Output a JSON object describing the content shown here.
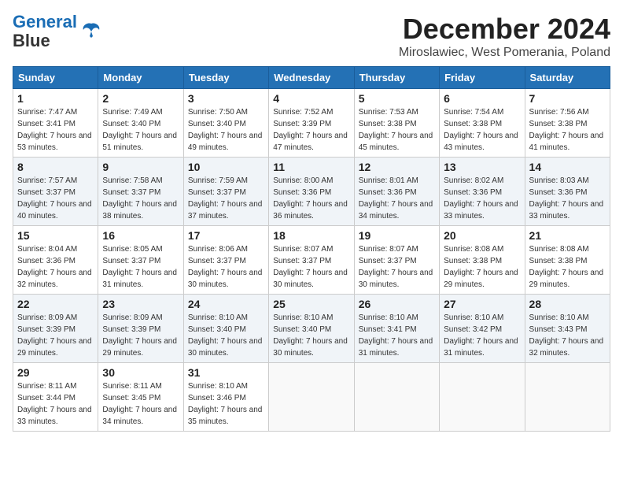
{
  "header": {
    "logo_line1": "General",
    "logo_line2": "Blue",
    "month_title": "December 2024",
    "location": "Miroslawiec, West Pomerania, Poland"
  },
  "days_of_week": [
    "Sunday",
    "Monday",
    "Tuesday",
    "Wednesday",
    "Thursday",
    "Friday",
    "Saturday"
  ],
  "weeks": [
    [
      {
        "day": "1",
        "sunrise": "7:47 AM",
        "sunset": "3:41 PM",
        "daylight": "7 hours and 53 minutes."
      },
      {
        "day": "2",
        "sunrise": "7:49 AM",
        "sunset": "3:40 PM",
        "daylight": "7 hours and 51 minutes."
      },
      {
        "day": "3",
        "sunrise": "7:50 AM",
        "sunset": "3:40 PM",
        "daylight": "7 hours and 49 minutes."
      },
      {
        "day": "4",
        "sunrise": "7:52 AM",
        "sunset": "3:39 PM",
        "daylight": "7 hours and 47 minutes."
      },
      {
        "day": "5",
        "sunrise": "7:53 AM",
        "sunset": "3:38 PM",
        "daylight": "7 hours and 45 minutes."
      },
      {
        "day": "6",
        "sunrise": "7:54 AM",
        "sunset": "3:38 PM",
        "daylight": "7 hours and 43 minutes."
      },
      {
        "day": "7",
        "sunrise": "7:56 AM",
        "sunset": "3:38 PM",
        "daylight": "7 hours and 41 minutes."
      }
    ],
    [
      {
        "day": "8",
        "sunrise": "7:57 AM",
        "sunset": "3:37 PM",
        "daylight": "7 hours and 40 minutes."
      },
      {
        "day": "9",
        "sunrise": "7:58 AM",
        "sunset": "3:37 PM",
        "daylight": "7 hours and 38 minutes."
      },
      {
        "day": "10",
        "sunrise": "7:59 AM",
        "sunset": "3:37 PM",
        "daylight": "7 hours and 37 minutes."
      },
      {
        "day": "11",
        "sunrise": "8:00 AM",
        "sunset": "3:36 PM",
        "daylight": "7 hours and 36 minutes."
      },
      {
        "day": "12",
        "sunrise": "8:01 AM",
        "sunset": "3:36 PM",
        "daylight": "7 hours and 34 minutes."
      },
      {
        "day": "13",
        "sunrise": "8:02 AM",
        "sunset": "3:36 PM",
        "daylight": "7 hours and 33 minutes."
      },
      {
        "day": "14",
        "sunrise": "8:03 AM",
        "sunset": "3:36 PM",
        "daylight": "7 hours and 33 minutes."
      }
    ],
    [
      {
        "day": "15",
        "sunrise": "8:04 AM",
        "sunset": "3:36 PM",
        "daylight": "7 hours and 32 minutes."
      },
      {
        "day": "16",
        "sunrise": "8:05 AM",
        "sunset": "3:37 PM",
        "daylight": "7 hours and 31 minutes."
      },
      {
        "day": "17",
        "sunrise": "8:06 AM",
        "sunset": "3:37 PM",
        "daylight": "7 hours and 30 minutes."
      },
      {
        "day": "18",
        "sunrise": "8:07 AM",
        "sunset": "3:37 PM",
        "daylight": "7 hours and 30 minutes."
      },
      {
        "day": "19",
        "sunrise": "8:07 AM",
        "sunset": "3:37 PM",
        "daylight": "7 hours and 30 minutes."
      },
      {
        "day": "20",
        "sunrise": "8:08 AM",
        "sunset": "3:38 PM",
        "daylight": "7 hours and 29 minutes."
      },
      {
        "day": "21",
        "sunrise": "8:08 AM",
        "sunset": "3:38 PM",
        "daylight": "7 hours and 29 minutes."
      }
    ],
    [
      {
        "day": "22",
        "sunrise": "8:09 AM",
        "sunset": "3:39 PM",
        "daylight": "7 hours and 29 minutes."
      },
      {
        "day": "23",
        "sunrise": "8:09 AM",
        "sunset": "3:39 PM",
        "daylight": "7 hours and 29 minutes."
      },
      {
        "day": "24",
        "sunrise": "8:10 AM",
        "sunset": "3:40 PM",
        "daylight": "7 hours and 30 minutes."
      },
      {
        "day": "25",
        "sunrise": "8:10 AM",
        "sunset": "3:40 PM",
        "daylight": "7 hours and 30 minutes."
      },
      {
        "day": "26",
        "sunrise": "8:10 AM",
        "sunset": "3:41 PM",
        "daylight": "7 hours and 31 minutes."
      },
      {
        "day": "27",
        "sunrise": "8:10 AM",
        "sunset": "3:42 PM",
        "daylight": "7 hours and 31 minutes."
      },
      {
        "day": "28",
        "sunrise": "8:10 AM",
        "sunset": "3:43 PM",
        "daylight": "7 hours and 32 minutes."
      }
    ],
    [
      {
        "day": "29",
        "sunrise": "8:11 AM",
        "sunset": "3:44 PM",
        "daylight": "7 hours and 33 minutes."
      },
      {
        "day": "30",
        "sunrise": "8:11 AM",
        "sunset": "3:45 PM",
        "daylight": "7 hours and 34 minutes."
      },
      {
        "day": "31",
        "sunrise": "8:10 AM",
        "sunset": "3:46 PM",
        "daylight": "7 hours and 35 minutes."
      },
      null,
      null,
      null,
      null
    ]
  ],
  "labels": {
    "sunrise": "Sunrise:",
    "sunset": "Sunset:",
    "daylight": "Daylight:"
  }
}
